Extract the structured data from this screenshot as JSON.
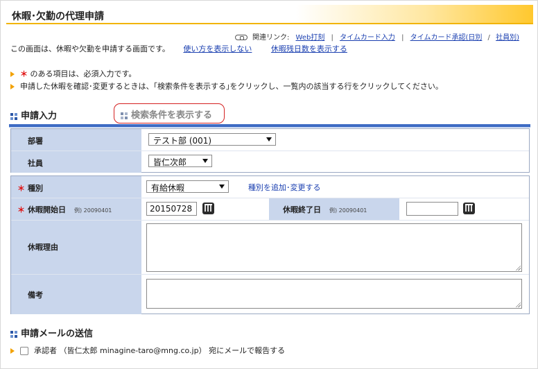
{
  "page": {
    "title": "休暇･欠勤の代理申請"
  },
  "related": {
    "prefix": "関連リンク:",
    "links": [
      "Web打刻",
      "タイムカード入力",
      "タイムカード承認(日別",
      "社員別)"
    ],
    "separators": [
      "|",
      "|",
      "/"
    ]
  },
  "intro": {
    "text": "この画面は、休暇や欠勤を申請する画面です。",
    "link1": "使い方を表示しない",
    "link2": "休暇残日数を表示する"
  },
  "notes": {
    "required_mark": "＊",
    "required_text": " のある項目は、必須入力です。",
    "confirm_text": "申請した休暇を確認･変更するときは、｢検索条件を表示する｣をクリックし、一覧内の該当する行をクリックしてください。"
  },
  "sections": {
    "apply": "申請入力",
    "search": "検索条件を表示する",
    "mail": "申請メールの送信"
  },
  "form": {
    "dept_label": "部署",
    "dept_value": "テスト部 (001)",
    "emp_label": "社員",
    "emp_value": "皆仁次郎",
    "type_label": "種別",
    "type_value": "有給休暇",
    "type_link": "種別を追加･変更する",
    "start_label": "休暇開始日",
    "start_example": "例) 20090401",
    "start_value": "20150728",
    "end_label": "休暇終了日",
    "end_example": "例) 20090401",
    "end_value": "",
    "reason_label": "休暇理由",
    "memo_label": "備考"
  },
  "mail": {
    "text": "承認者 （皆仁太郎 minagine-taro@mng.co.jp） 宛にメールで報告する",
    "checked": false
  },
  "colors": {
    "accent": "#f2b400",
    "label_bg": "#c9d6ec",
    "bar": "#3f6cc4",
    "link": "#1a3fb0",
    "required": "#e01010"
  }
}
